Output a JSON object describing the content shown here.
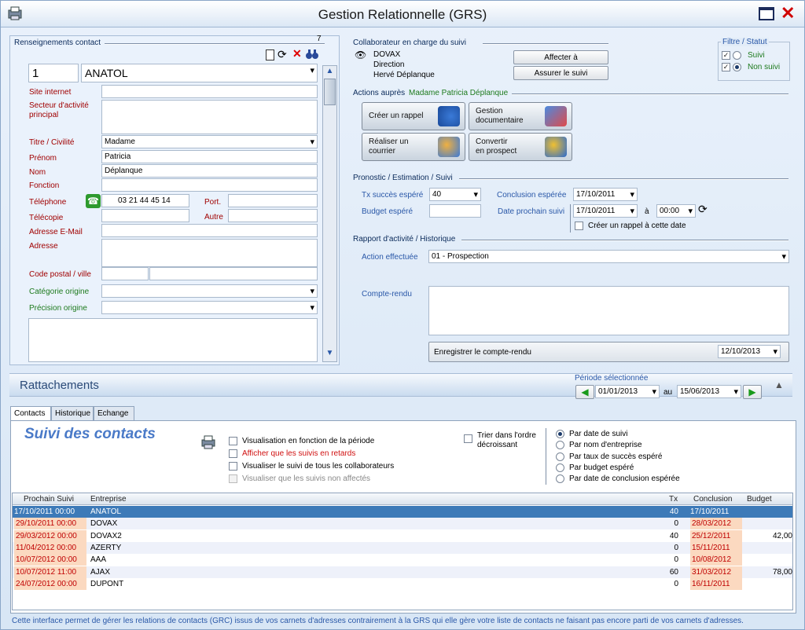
{
  "window": {
    "title": "Gestion Relationnelle (GRS)"
  },
  "contact": {
    "section_title": "Renseignements contact",
    "count": "7",
    "id": "1",
    "company": "ANATOL",
    "labels": {
      "site": "Site internet",
      "secteur": "Secteur d'activité principal",
      "titre": "Titre / Civilité",
      "prenom": "Prénom",
      "nom": "Nom",
      "fonction": "Fonction",
      "telephone": "Téléphone",
      "telecopie": "Télécopie",
      "email": "Adresse E-Mail",
      "adresse": "Adresse",
      "cp": "Code postal / ville",
      "categorie": "Catégorie origine",
      "precision": "Précision origine",
      "port": "Port.",
      "autre": "Autre"
    },
    "values": {
      "titre": "Madame",
      "prenom": "Patricia",
      "nom": "Déplanque",
      "telephone": "03 21 44 45 14"
    }
  },
  "collab": {
    "section_title": "Collaborateur en charge du suivi",
    "line1": "DOVAX",
    "line2": "Direction",
    "line3": "Hervé Déplanque",
    "btn_affecter": "Affecter à",
    "btn_assurer": "Assurer le suivi"
  },
  "filtre": {
    "title": "Filtre / Statut",
    "opt1": "Suivi",
    "opt2": "Non suivi"
  },
  "actions": {
    "section_prefix": "Actions auprès",
    "section_name": "Madame Patricia Déplanque",
    "b1": "Créer un rappel",
    "b2a": "Gestion",
    "b2b": "documentaire",
    "b3a": "Réaliser un",
    "b3b": "courrier",
    "b4a": "Convertir",
    "b4b": "en prospect"
  },
  "prono": {
    "section_title": "Pronostic / Estimation / Suivi",
    "tx_label": "Tx succès espéré",
    "tx_value": "40",
    "budget_label": "Budget espéré",
    "conclusion_label": "Conclusion espérée",
    "conclusion_value": "17/10/2011",
    "date_label": "Date prochain suivi",
    "date_value": "17/10/2011",
    "a": "à",
    "time": "00:00",
    "rappel_label": "Créer un rappel à cette date"
  },
  "rapport": {
    "section_title": "Rapport d'activité / Historique",
    "action_label": "Action effectuée",
    "action_value": "01 - Prospection",
    "cr_label": "Compte-rendu",
    "save_label": "Enregistrer le compte-rendu",
    "save_date": "12/10/2013"
  },
  "ratt": {
    "title": "Rattachements",
    "periode": "Période sélectionnée",
    "from": "01/01/2013",
    "au": "au",
    "to": "15/06/2013"
  },
  "tabs": [
    "Contacts",
    "Historique",
    "Echange"
  ],
  "suivi": {
    "title": "Suivi des contacts",
    "c1": "Visualisation en fonction de la période",
    "c2": "Afficher que les suivis en retards",
    "c3": "Visualiser le suivi de tous les collaborateurs",
    "c4": "Visualiser que les suivis non affectés",
    "trier1": "Trier dans l'ordre",
    "trier2": "décroissant",
    "r1": "Par date de suivi",
    "r2": "Par nom d'entreprise",
    "r3": "Par taux de succès espéré",
    "r4": "Par budget espéré",
    "r5": "Par date de conclusion espérée"
  },
  "grid": {
    "headers": [
      "Prochain Suivi",
      "Entreprise",
      "Tx",
      "Conclusion",
      "Budget"
    ],
    "rows": [
      [
        "17/10/2011  00:00",
        "ANATOL",
        "40",
        "17/10/2011",
        ""
      ],
      [
        "29/10/2011  00:00",
        "DOVAX",
        "0",
        "28/03/2012",
        ""
      ],
      [
        "29/03/2012  00:00",
        "DOVAX2",
        "40",
        "25/12/2011",
        "42,00"
      ],
      [
        "11/04/2012  00:00",
        "AZERTY",
        "0",
        "15/11/2011",
        ""
      ],
      [
        "10/07/2012  00:00",
        "AAA",
        "0",
        "10/08/2012",
        ""
      ],
      [
        "10/07/2012  11:00",
        "AJAX",
        "60",
        "31/03/2012",
        "78,00"
      ],
      [
        "24/07/2012  00:00",
        "DUPONT",
        "0",
        "16/11/2011",
        ""
      ]
    ]
  },
  "footer": "Cette interface permet de gérer les relations de contacts (GRC) issus de vos carnets d'adresses contrairement à la GRS qui elle gère votre liste de contacts ne faisant pas encore parti de vos carnets d'adresses.",
  "colors": {
    "selected_row": "#3d7ab8",
    "orange": "#fbd9c0",
    "label_red": "#a00000",
    "label_blue": "#2a58a8"
  }
}
